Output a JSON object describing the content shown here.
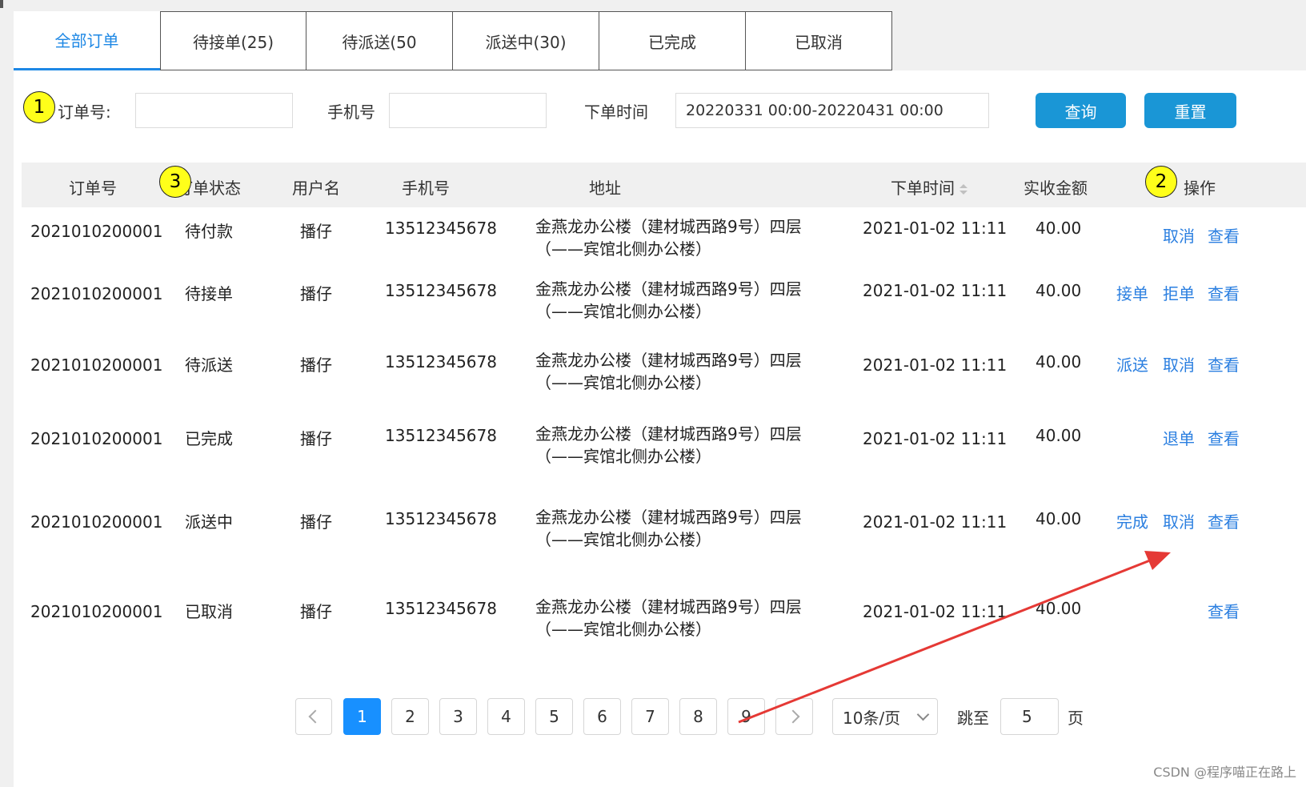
{
  "tabs": [
    {
      "label": "全部订单"
    },
    {
      "label": "待接单(25)"
    },
    {
      "label": "待派送(50"
    },
    {
      "label": "派送中(30)"
    },
    {
      "label": "已完成"
    },
    {
      "label": "已取消"
    }
  ],
  "filters": {
    "order_no_label": "订单号:",
    "order_no_value": "",
    "phone_label": "手机号",
    "phone_value": "",
    "time_label": "下单时间",
    "time_value": "20220331 00:00-20220431 00:00",
    "query_button": "查询",
    "reset_button": "重置"
  },
  "annotations": {
    "badge1": "1",
    "badge2": "2",
    "badge3": "3",
    "arrow_color": "#e53935"
  },
  "table": {
    "headers": {
      "order_no": "订单号",
      "status": "订单状态",
      "user": "用户名",
      "phone": "手机号",
      "address": "地址",
      "time": "下单时间",
      "amount": "实收金额",
      "actions": "操作"
    },
    "rows": [
      {
        "order_no": "2021010200001",
        "status": "待付款",
        "user": "播仔",
        "phone": "13512345678",
        "addr1": "金燕龙办公楼（建材城西路9号）四层",
        "addr2": "（——宾馆北侧办公楼）",
        "time": "2021-01-02 11:11",
        "amount": "40.00",
        "actions": [
          "取消",
          "查看"
        ]
      },
      {
        "order_no": "2021010200001",
        "status": "待接单",
        "user": "播仔",
        "phone": "13512345678",
        "addr1": "金燕龙办公楼（建材城西路9号）四层",
        "addr2": "（——宾馆北侧办公楼）",
        "time": "2021-01-02 11:11",
        "amount": "40.00",
        "actions": [
          "接单",
          "拒单",
          "查看"
        ]
      },
      {
        "order_no": "2021010200001",
        "status": "待派送",
        "user": "播仔",
        "phone": "13512345678",
        "addr1": "金燕龙办公楼（建材城西路9号）四层",
        "addr2": "（——宾馆北侧办公楼）",
        "time": "2021-01-02 11:11",
        "amount": "40.00",
        "actions": [
          "派送",
          "取消",
          "查看"
        ]
      },
      {
        "order_no": "2021010200001",
        "status": "已完成",
        "user": "播仔",
        "phone": "13512345678",
        "addr1": "金燕龙办公楼（建材城西路9号）四层",
        "addr2": "（——宾馆北侧办公楼）",
        "time": "2021-01-02 11:11",
        "amount": "40.00",
        "actions": [
          "退单",
          "查看"
        ]
      },
      {
        "order_no": "2021010200001",
        "status": "派送中",
        "user": "播仔",
        "phone": "13512345678",
        "addr1": "金燕龙办公楼（建材城西路9号）四层",
        "addr2": "（——宾馆北侧办公楼）",
        "time": "2021-01-02 11:11",
        "amount": "40.00",
        "actions": [
          "完成",
          "取消",
          "查看"
        ]
      },
      {
        "order_no": "2021010200001",
        "status": "已取消",
        "user": "播仔",
        "phone": "13512345678",
        "addr1": "金燕龙办公楼（建材城西路9号）四层",
        "addr2": "（——宾馆北侧办公楼）",
        "time": "2021-01-02 11:11",
        "amount": "40.00",
        "actions": [
          "查看"
        ]
      }
    ]
  },
  "pagination": {
    "pages": [
      "1",
      "2",
      "3",
      "4",
      "5",
      "6",
      "7",
      "8",
      "9"
    ],
    "current": "1",
    "page_size": "10条/页",
    "jump_label": "跳至",
    "jump_value": "5",
    "page_suffix": "页"
  },
  "watermark": "CSDN @程序喵正在路上"
}
